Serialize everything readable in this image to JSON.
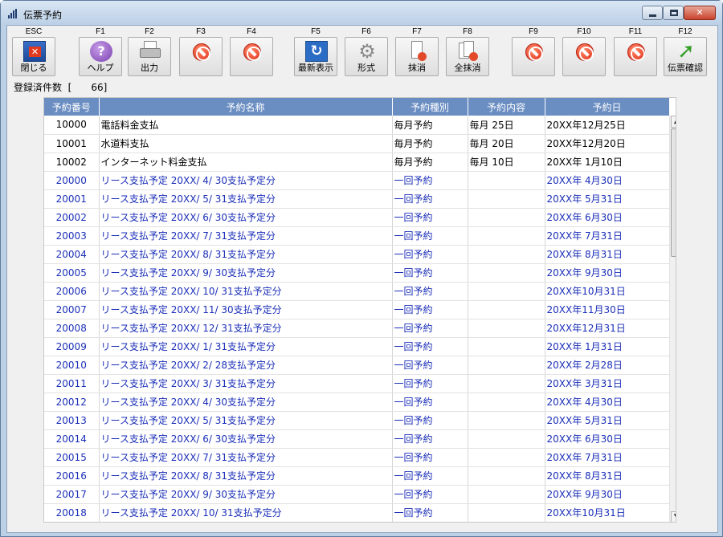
{
  "window": {
    "title": "伝票予約"
  },
  "toolbar": [
    {
      "key": "ESC",
      "label": "閉じる",
      "icon": "close-x-icon"
    },
    {
      "key": "F1",
      "label": "ヘルプ",
      "icon": "help-icon"
    },
    {
      "key": "F2",
      "label": "出力",
      "icon": "print-icon"
    },
    {
      "key": "F3",
      "label": "",
      "icon": "disabled-icon"
    },
    {
      "key": "F4",
      "label": "",
      "icon": "disabled-icon"
    },
    {
      "key": "F5",
      "label": "最新表示",
      "icon": "refresh-icon"
    },
    {
      "key": "F6",
      "label": "形式",
      "icon": "gear-icon"
    },
    {
      "key": "F7",
      "label": "抹消",
      "icon": "delete-doc-icon"
    },
    {
      "key": "F8",
      "label": "全抹消",
      "icon": "delete-all-icon"
    },
    {
      "key": "F9",
      "label": "",
      "icon": "disabled-icon"
    },
    {
      "key": "F10",
      "label": "",
      "icon": "disabled-icon"
    },
    {
      "key": "F11",
      "label": "",
      "icon": "disabled-icon"
    },
    {
      "key": "F12",
      "label": "伝票確認",
      "icon": "arrow-up-right-icon"
    }
  ],
  "status": {
    "label": "登録済件数",
    "count": "[　　66]"
  },
  "table": {
    "headers": [
      "予約番号",
      "予約名称",
      "予約種別",
      "予約内容",
      "予約日"
    ],
    "rows": [
      {
        "no": "10000",
        "name": "電話料金支払",
        "type": "毎月予約",
        "detail": "毎月 25日",
        "date": "20XX年12月25日",
        "style": "black"
      },
      {
        "no": "10001",
        "name": "水道料支払",
        "type": "毎月予約",
        "detail": "毎月 20日",
        "date": "20XX年12月20日",
        "style": "black"
      },
      {
        "no": "10002",
        "name": "インターネット料金支払",
        "type": "毎月予約",
        "detail": "毎月 10日",
        "date": "20XX年 1月10日",
        "style": "black"
      },
      {
        "no": "20000",
        "name": "リース支払予定 20XX/  4/ 30支払予定分",
        "type": "一回予約",
        "detail": "",
        "date": "20XX年 4月30日",
        "style": "blue"
      },
      {
        "no": "20001",
        "name": "リース支払予定 20XX/  5/ 31支払予定分",
        "type": "一回予約",
        "detail": "",
        "date": "20XX年 5月31日",
        "style": "blue"
      },
      {
        "no": "20002",
        "name": "リース支払予定 20XX/  6/ 30支払予定分",
        "type": "一回予約",
        "detail": "",
        "date": "20XX年 6月30日",
        "style": "blue"
      },
      {
        "no": "20003",
        "name": "リース支払予定 20XX/  7/ 31支払予定分",
        "type": "一回予約",
        "detail": "",
        "date": "20XX年 7月31日",
        "style": "blue"
      },
      {
        "no": "20004",
        "name": "リース支払予定 20XX/  8/ 31支払予定分",
        "type": "一回予約",
        "detail": "",
        "date": "20XX年 8月31日",
        "style": "blue"
      },
      {
        "no": "20005",
        "name": "リース支払予定 20XX/  9/ 30支払予定分",
        "type": "一回予約",
        "detail": "",
        "date": "20XX年 9月30日",
        "style": "blue"
      },
      {
        "no": "20006",
        "name": "リース支払予定 20XX/ 10/ 31支払予定分",
        "type": "一回予約",
        "detail": "",
        "date": "20XX年10月31日",
        "style": "blue"
      },
      {
        "no": "20007",
        "name": "リース支払予定 20XX/ 11/ 30支払予定分",
        "type": "一回予約",
        "detail": "",
        "date": "20XX年11月30日",
        "style": "blue"
      },
      {
        "no": "20008",
        "name": "リース支払予定 20XX/ 12/ 31支払予定分",
        "type": "一回予約",
        "detail": "",
        "date": "20XX年12月31日",
        "style": "blue"
      },
      {
        "no": "20009",
        "name": "リース支払予定 20XX/  1/ 31支払予定分",
        "type": "一回予約",
        "detail": "",
        "date": "20XX年 1月31日",
        "style": "blue"
      },
      {
        "no": "20010",
        "name": "リース支払予定 20XX/  2/ 28支払予定分",
        "type": "一回予約",
        "detail": "",
        "date": "20XX年 2月28日",
        "style": "blue"
      },
      {
        "no": "20011",
        "name": "リース支払予定 20XX/  3/ 31支払予定分",
        "type": "一回予約",
        "detail": "",
        "date": "20XX年 3月31日",
        "style": "blue"
      },
      {
        "no": "20012",
        "name": "リース支払予定 20XX/  4/ 30支払予定分",
        "type": "一回予約",
        "detail": "",
        "date": "20XX年 4月30日",
        "style": "blue"
      },
      {
        "no": "20013",
        "name": "リース支払予定 20XX/  5/ 31支払予定分",
        "type": "一回予約",
        "detail": "",
        "date": "20XX年 5月31日",
        "style": "blue"
      },
      {
        "no": "20014",
        "name": "リース支払予定 20XX/  6/ 30支払予定分",
        "type": "一回予約",
        "detail": "",
        "date": "20XX年 6月30日",
        "style": "blue"
      },
      {
        "no": "20015",
        "name": "リース支払予定 20XX/  7/ 31支払予定分",
        "type": "一回予約",
        "detail": "",
        "date": "20XX年 7月31日",
        "style": "blue"
      },
      {
        "no": "20016",
        "name": "リース支払予定 20XX/  8/ 31支払予定分",
        "type": "一回予約",
        "detail": "",
        "date": "20XX年 8月31日",
        "style": "blue"
      },
      {
        "no": "20017",
        "name": "リース支払予定 20XX/  9/ 30支払予定分",
        "type": "一回予約",
        "detail": "",
        "date": "20XX年 9月30日",
        "style": "blue"
      },
      {
        "no": "20018",
        "name": "リース支払予定 20XX/ 10/ 31支払予定分",
        "type": "一回予約",
        "detail": "",
        "date": "20XX年10月31日",
        "style": "blue"
      }
    ]
  },
  "colors": {
    "header_bg": "#6a8dc2",
    "row_blue": "#1b2fb8",
    "title_bg": "#bcd0e6"
  }
}
